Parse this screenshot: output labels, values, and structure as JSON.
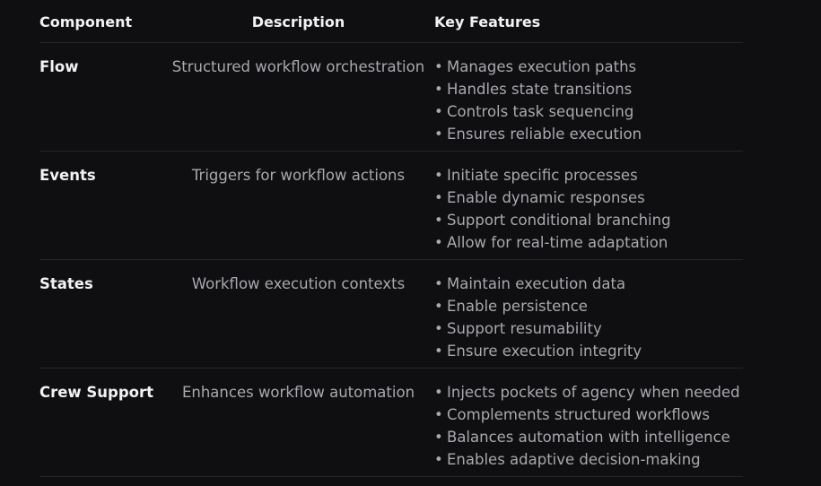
{
  "headers": {
    "component": "Component",
    "description": "Description",
    "features": "Key Features"
  },
  "rows": [
    {
      "component": "Flow",
      "description": "Structured workflow orchestration",
      "features": [
        "Manages execution paths",
        "Handles state transitions",
        "Controls task sequencing",
        "Ensures reliable execution"
      ]
    },
    {
      "component": "Events",
      "description": "Triggers for workflow actions",
      "features": [
        "Initiate specific processes",
        "Enable dynamic responses",
        "Support conditional branching",
        "Allow for real-time adaptation"
      ]
    },
    {
      "component": "States",
      "description": "Workflow execution contexts",
      "features": [
        "Maintain execution data",
        "Enable persistence",
        "Support resumability",
        "Ensure execution integrity"
      ]
    },
    {
      "component": "Crew Support",
      "description": "Enhances workflow automation",
      "features": [
        "Injects pockets of agency when needed",
        "Complements structured workflows",
        "Balances automation with intelligence",
        "Enables adaptive decision-making"
      ]
    }
  ],
  "bullet_glyph": "•"
}
